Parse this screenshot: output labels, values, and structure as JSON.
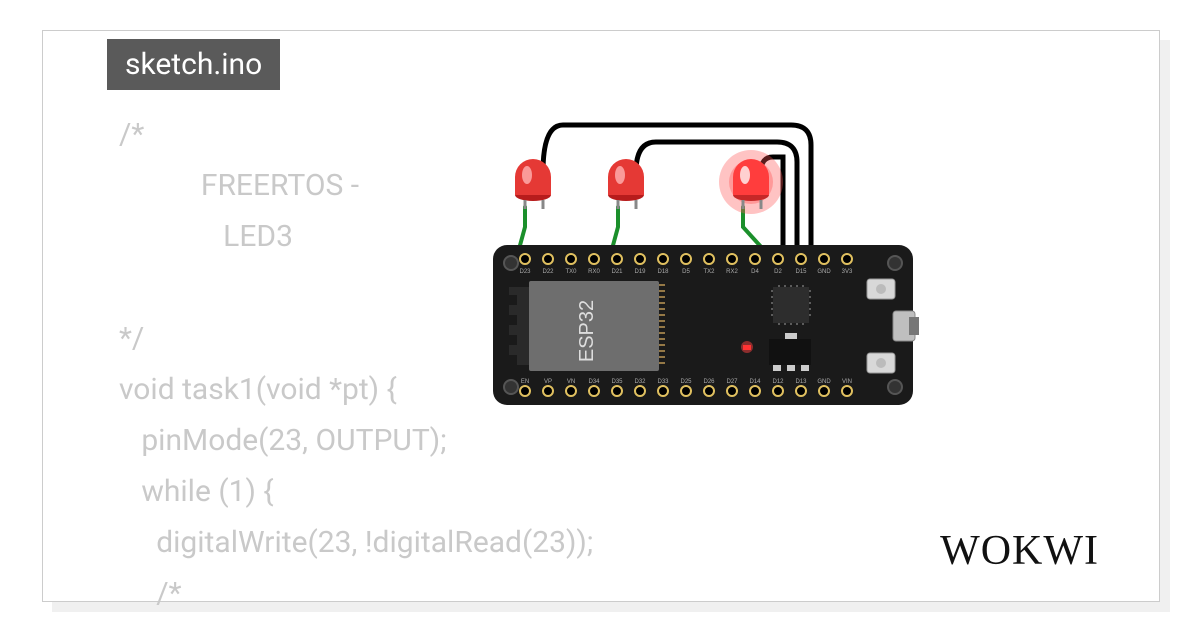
{
  "tab": {
    "filename": "sketch.ino"
  },
  "code": {
    "text": "/*\n           FREERTOS -\n              LED3\n\n*/\nvoid task1(void *pt) {\n   pinMode(23, OUTPUT);\n   while (1) {\n     digitalWrite(23, !digitalRead(23));\n     /*"
  },
  "board": {
    "chip_label": "ESP32"
  },
  "brand": {
    "logo": "WOKWI"
  },
  "colors": {
    "led_red": "#e53935",
    "led_glow": "#ff6b6b",
    "wire_green": "#1b8f2b",
    "wire_black": "#000",
    "board": "#1a1a1a",
    "chip": "#616161"
  },
  "pins_top": [
    "D23",
    "D22",
    "TX0",
    "RX0",
    "D21",
    "D19",
    "D18",
    "D5",
    "TX2",
    "RX2",
    "D4",
    "D2",
    "D15",
    "GND",
    "3V3"
  ],
  "pins_bottom": [
    "EN",
    "VP",
    "VN",
    "D34",
    "D35",
    "D32",
    "D33",
    "D25",
    "D26",
    "D27",
    "D14",
    "D12",
    "D13",
    "GND",
    "VIN"
  ]
}
